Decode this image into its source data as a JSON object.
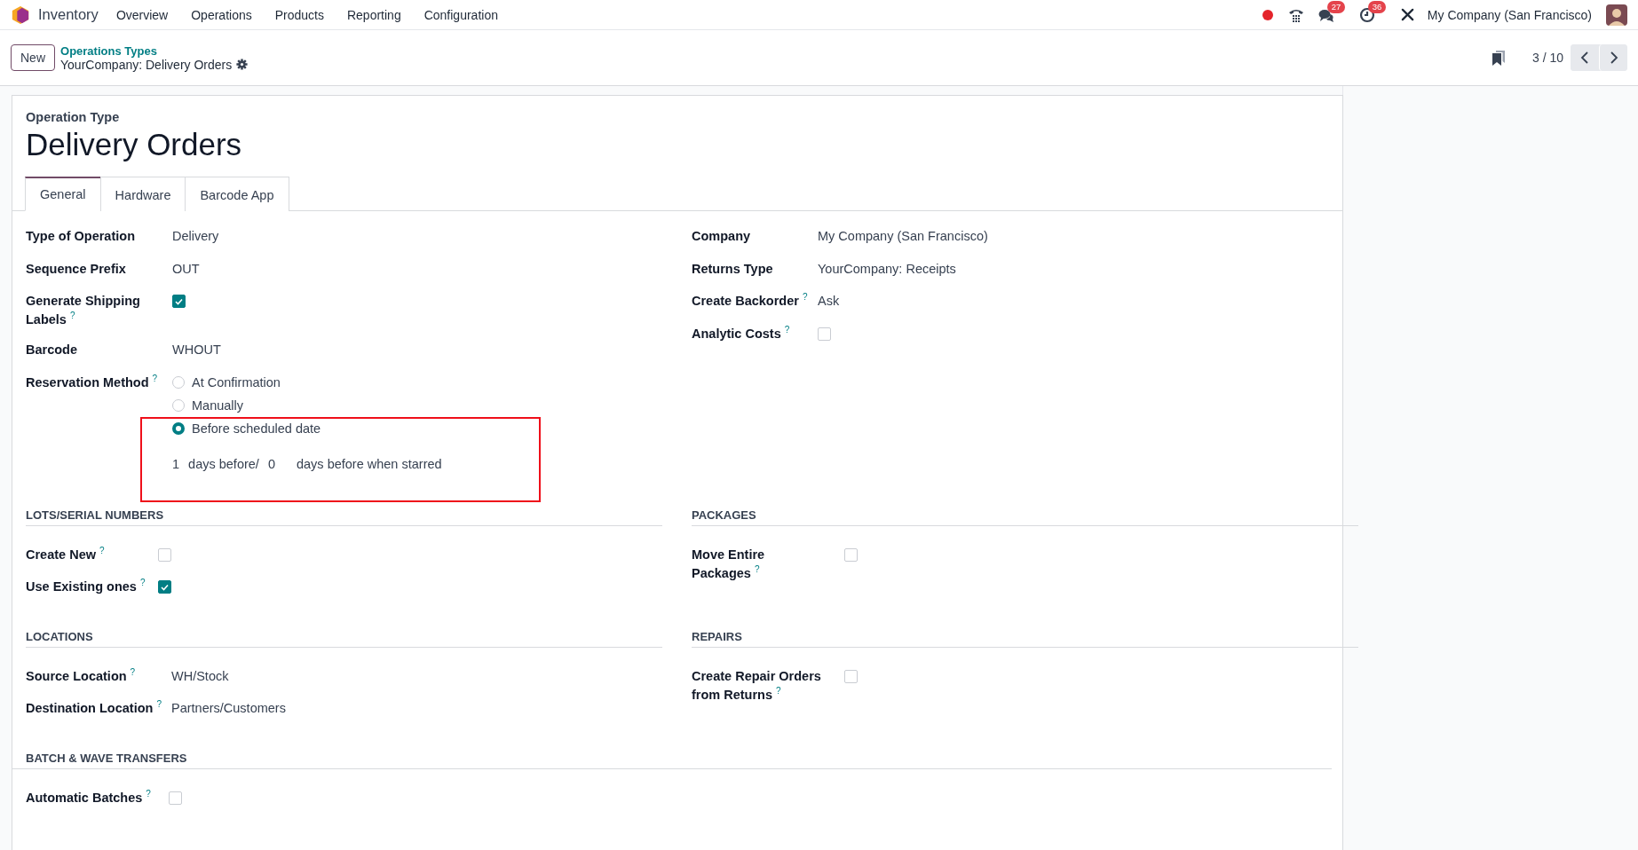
{
  "navbar": {
    "app": "Inventory",
    "menu": [
      "Overview",
      "Operations",
      "Products",
      "Reporting",
      "Configuration"
    ],
    "messages_count": "27",
    "activities_count": "36",
    "company": "My Company (San Francisco)"
  },
  "control_panel": {
    "new_button": "New",
    "breadcrumb": "Operations Types",
    "record": "YourCompany: Delivery Orders",
    "pager": "3 / 10"
  },
  "form": {
    "subtitle": "Operation Type",
    "title": "Delivery Orders",
    "tabs": [
      {
        "label": "General",
        "selected": true
      },
      {
        "label": "Hardware",
        "selected": false
      },
      {
        "label": "Barcode App",
        "selected": false
      }
    ],
    "left_fields": [
      {
        "kind": "text",
        "label": "Type of Operation",
        "value": "Delivery"
      },
      {
        "kind": "text",
        "label": "Sequence Prefix",
        "value": "OUT"
      },
      {
        "kind": "checkbox",
        "label": "Generate Shipping Labels",
        "help": "?",
        "checked": true
      },
      {
        "kind": "text",
        "label": "Barcode",
        "value": "WHOUT"
      },
      {
        "kind": "radio",
        "label": "Reservation Method",
        "help": "?",
        "options": [
          {
            "label": "At Confirmation",
            "selected": false
          },
          {
            "label": "Manually",
            "selected": false
          },
          {
            "label": "Before scheduled date",
            "selected": true
          }
        ],
        "days": {
          "before_value": "1",
          "before_text": "days before/",
          "starred_value": "0",
          "starred_text": "days before when starred"
        }
      }
    ],
    "right_fields": [
      {
        "kind": "text",
        "label": "Company",
        "value": "My Company (San Francisco)"
      },
      {
        "kind": "text",
        "label": "Returns Type",
        "value": "YourCompany: Receipts"
      },
      {
        "kind": "text",
        "label": "Create Backorder",
        "help": "?",
        "value": "Ask"
      },
      {
        "kind": "checkbox",
        "label": "Analytic Costs",
        "help": "?",
        "checked": false
      }
    ],
    "sections": [
      {
        "title": "LOTS/SERIAL NUMBERS",
        "fields": [
          {
            "kind": "checkbox",
            "label": "Create New",
            "help": "?",
            "checked": false
          },
          {
            "kind": "checkbox",
            "label": "Use Existing ones",
            "help": "?",
            "checked": true
          }
        ]
      },
      {
        "title": "PACKAGES",
        "fields": [
          {
            "kind": "checkbox",
            "label": "Move Entire Packages",
            "help": "?",
            "checked": false
          }
        ]
      },
      {
        "title": "LOCATIONS",
        "fields": [
          {
            "kind": "text",
            "label": "Source Location",
            "help": "?",
            "value": "WH/Stock"
          },
          {
            "kind": "text",
            "label": "Destination Location",
            "help": "?",
            "value": "Partners/Customers"
          }
        ]
      },
      {
        "title": "REPAIRS",
        "fields": [
          {
            "kind": "checkbox",
            "label": "Create Repair Orders from Returns",
            "help": "?",
            "checked": false
          }
        ]
      },
      {
        "title": "BATCH & WAVE TRANSFERS",
        "fields": [
          {
            "kind": "checkbox",
            "label": "Automatic Batches",
            "help": "?",
            "checked": false
          }
        ]
      }
    ]
  }
}
